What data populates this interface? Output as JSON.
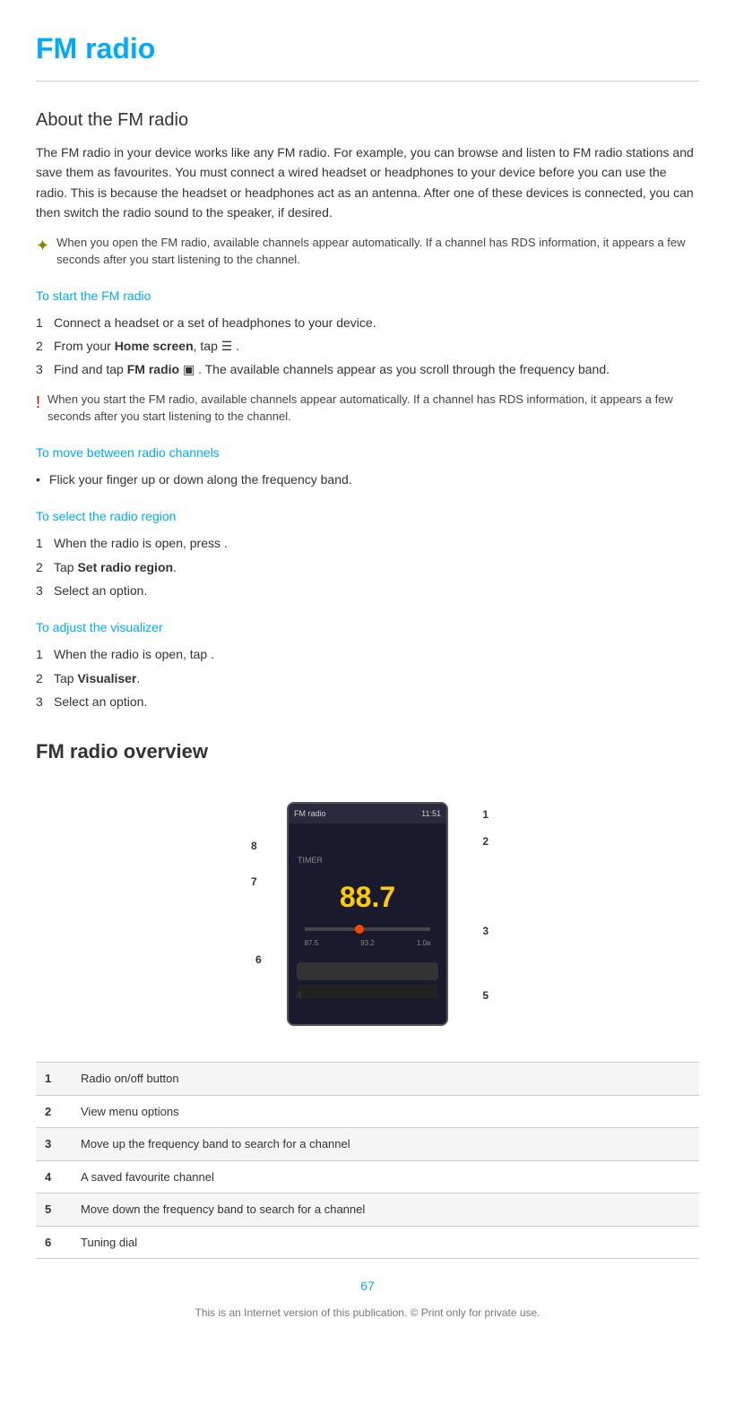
{
  "page": {
    "title": "FM radio",
    "about_heading": "About the FM radio",
    "about_body": "The FM radio in your device works like any FM radio. For example, you can browse and listen to FM radio stations and save them as favourites. You must connect a wired headset or headphones to your device before you can use the radio. This is because the headset or headphones act as an antenna. After one of these devices is connected, you can then switch the radio sound to the speaker, if desired.",
    "tip1": "When you open the FM radio, available channels appear automatically. If a channel has RDS information, it appears a few seconds after you start listening to the channel.",
    "start_heading": "To start the FM radio",
    "start_steps": [
      "Connect a headset or a set of headphones to your device.",
      "From your Home screen, tap .",
      "Find and tap FM radio  . The available channels appear as you scroll through the frequency band."
    ],
    "start_step2_bold": "Home screen",
    "start_step3_bold": "FM radio",
    "warning1": "When you start the FM radio, available channels appear automatically. If a channel has RDS information, it appears a few seconds after you start listening to the channel.",
    "move_heading": "To move between radio channels",
    "move_bullet": "Flick your finger up or down along the frequency band.",
    "region_heading": "To select the radio region",
    "region_steps": [
      "When the radio is open, press .",
      "Tap Set radio region.",
      "Select an option."
    ],
    "region_step2_bold": "Set radio region",
    "visualizer_heading": "To adjust the visualizer",
    "visualizer_steps": [
      "When the radio is open, tap .",
      "Tap Visualiser.",
      "Select an option."
    ],
    "visualizer_step2_bold": "Visualiser",
    "overview_heading": "FM radio overview",
    "frequency": "88.7",
    "table": [
      {
        "num": "1",
        "label": "Radio on/off button"
      },
      {
        "num": "2",
        "label": "View menu options"
      },
      {
        "num": "3",
        "label": "Move up the frequency band to search for a channel"
      },
      {
        "num": "4",
        "label": "A saved favourite channel"
      },
      {
        "num": "5",
        "label": "Move down the frequency band to search for a channel"
      },
      {
        "num": "6",
        "label": "Tuning dial"
      }
    ],
    "page_number": "67",
    "footer": "This is an Internet version of this publication. © Print only for private use."
  }
}
